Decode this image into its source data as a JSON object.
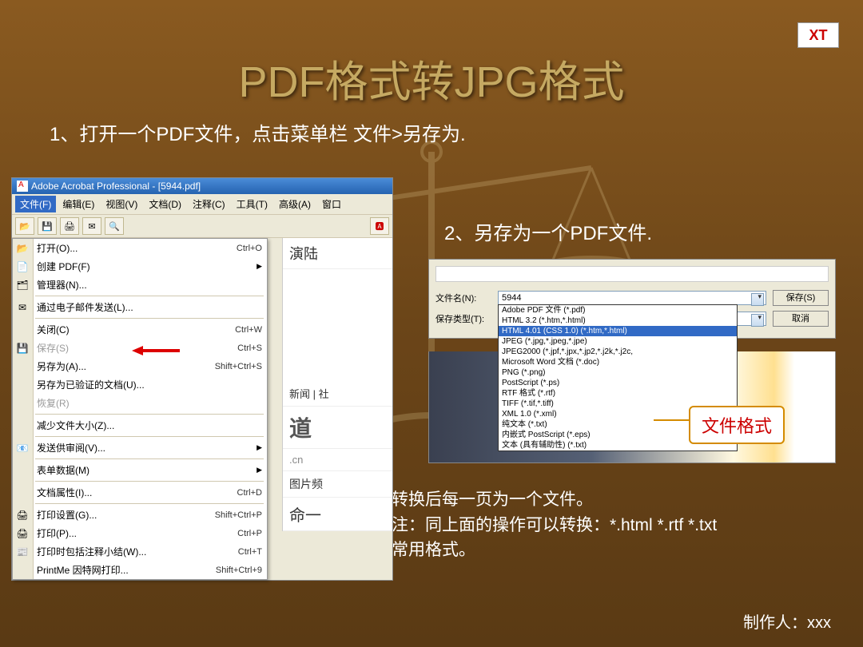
{
  "logo": "XT",
  "title": "PDF格式转JPG格式",
  "step1": "1、打开一个PDF文件，点击菜单栏 文件>另存为.",
  "step2": "2、另存为一个PDF文件.",
  "note_l1": "转换后每一页为一个文件。",
  "note_l2": "注：同上面的操作可以转换：*.html  *.rtf   *.txt",
  "note_l3": "常用格式。",
  "author": "制作人：xxx",
  "acrobat": {
    "title": "Adobe Acrobat Professional - [5944.pdf]",
    "menus": [
      "文件(F)",
      "编辑(E)",
      "视图(V)",
      "文档(D)",
      "注释(C)",
      "工具(T)",
      "高级(A)",
      "窗口"
    ],
    "items": [
      {
        "icon": "📂",
        "label": "打开(O)...",
        "sc": "Ctrl+O"
      },
      {
        "icon": "📄",
        "label": "创建 PDF(F)",
        "arrow": true
      },
      {
        "icon": "🗂",
        "label": "管理器(N)..."
      },
      {
        "sep": true
      },
      {
        "icon": "✉",
        "label": "通过电子邮件发送(L)..."
      },
      {
        "sep": true
      },
      {
        "label": "关闭(C)",
        "sc": "Ctrl+W"
      },
      {
        "icon": "💾",
        "label": "保存(S)",
        "sc": "Ctrl+S",
        "disabled": true
      },
      {
        "label": "另存为(A)...",
        "sc": "Shift+Ctrl+S"
      },
      {
        "label": "另存为已验证的文档(U)..."
      },
      {
        "label": "恢复(R)",
        "disabled": true
      },
      {
        "sep": true
      },
      {
        "label": "减少文件大小(Z)..."
      },
      {
        "sep": true
      },
      {
        "icon": "📧",
        "label": "发送供审阅(V)...",
        "arrow": true
      },
      {
        "sep": true
      },
      {
        "label": "表单数据(M)",
        "arrow": true
      },
      {
        "sep": true
      },
      {
        "label": "文档属性(I)...",
        "sc": "Ctrl+D"
      },
      {
        "sep": true
      },
      {
        "icon": "🖨",
        "label": "打印设置(G)...",
        "sc": "Shift+Ctrl+P"
      },
      {
        "icon": "🖨",
        "label": "打印(P)...",
        "sc": "Ctrl+P"
      },
      {
        "icon": "📰",
        "label": "打印时包括注释小结(W)...",
        "sc": "Ctrl+T"
      },
      {
        "label": "PrintMe 因特网打印...",
        "sc": "Shift+Ctrl+9"
      }
    ],
    "behind": [
      "演陆",
      "新闻 | 社",
      "道",
      ".cn",
      "图片频",
      "命一"
    ]
  },
  "dialog": {
    "filename_label": "文件名(N):",
    "filename_value": "5944",
    "type_label": "保存类型(T):",
    "type_value": "Adobe PDF 文件 (*.pdf)",
    "save_btn": "保存(S)",
    "cancel_btn": "取消",
    "options": [
      "Adobe PDF 文件 (*.pdf)",
      "HTML 3.2 (*.htm,*.html)",
      {
        "sel": true,
        "text": "HTML 4.01 (CSS 1.0) (*.htm,*.html)"
      },
      "JPEG (*.jpg,*.jpeg,*.jpe)",
      "JPEG2000 (*.jpf,*.jpx,*.jp2,*.j2k,*.j2c,",
      "Microsoft Word 文档 (*.doc)",
      "PNG (*.png)",
      "PostScript (*.ps)",
      "RTF 格式 (*.rtf)",
      "TIFF (*.tif,*.tiff)",
      "XML 1.0 (*.xml)",
      "纯文本 (*.txt)",
      "内嵌式 PostScript (*.eps)",
      "文本 (具有辅助性) (*.txt)"
    ]
  },
  "callout": "文件格式"
}
